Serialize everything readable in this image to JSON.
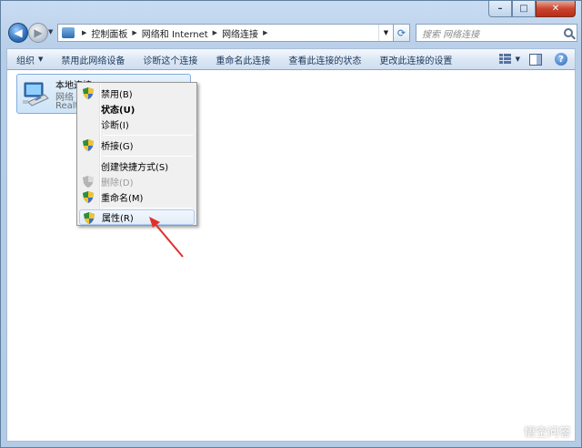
{
  "window": {
    "caption": {
      "minimize": "–",
      "maximize": "□",
      "close": "✕"
    }
  },
  "nav": {
    "back": "◀",
    "forward": "▶",
    "breadcrumbs": [
      "控制面板",
      "网络和 Internet",
      "网络连接"
    ],
    "search_placeholder": "搜索 网络连接",
    "refresh": "⟳"
  },
  "toolbar": {
    "organize": "组织",
    "items": [
      "禁用此网络设备",
      "诊断这个连接",
      "重命名此连接",
      "查看此连接的状态",
      "更改此连接的设置"
    ],
    "help": "?"
  },
  "connection": {
    "name": "本地连接",
    "network": "网络",
    "adapter": "Realt"
  },
  "context_menu": {
    "items": [
      {
        "label": "禁用(B)",
        "shield": true,
        "bold": false,
        "disabled": false
      },
      {
        "label": "状态(U)",
        "shield": false,
        "bold": true,
        "disabled": false
      },
      {
        "label": "诊断(I)",
        "shield": false,
        "bold": false,
        "disabled": false
      },
      {
        "label": "桥接(G)",
        "shield": true,
        "bold": false,
        "disabled": false
      },
      {
        "label": "创建快捷方式(S)",
        "shield": false,
        "bold": false,
        "disabled": false
      },
      {
        "label": "删除(D)",
        "shield": true,
        "bold": false,
        "disabled": true
      },
      {
        "label": "重命名(M)",
        "shield": true,
        "bold": false,
        "disabled": false
      },
      {
        "label": "属性(R)",
        "shield": true,
        "bold": false,
        "disabled": false,
        "highlighted": true
      }
    ]
  },
  "watermark": {
    "text": "悟空问答"
  },
  "colors": {
    "annotation_arrow": "#e0302a",
    "selection": "#cde4f7"
  }
}
